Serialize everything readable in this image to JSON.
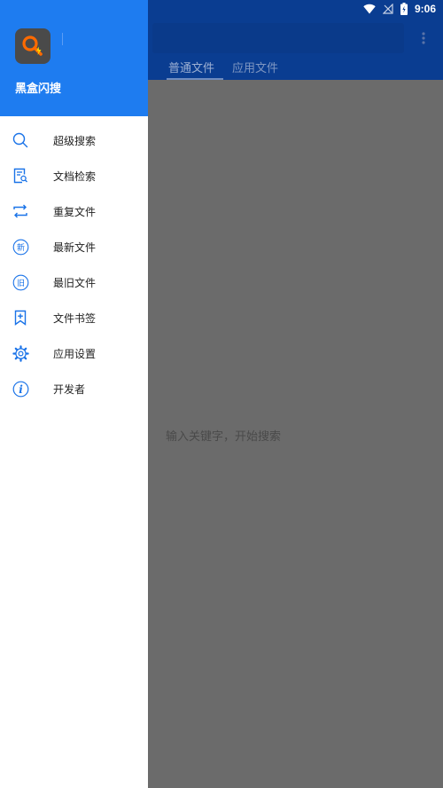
{
  "status_bar": {
    "time": "9:06"
  },
  "main": {
    "tabs": [
      {
        "label": "普通文件",
        "active": true
      },
      {
        "label": "应用文件",
        "active": false
      }
    ],
    "empty_hint": "输入关键字，开始搜索"
  },
  "drawer": {
    "app_name": "黑盒闪搜",
    "items": [
      {
        "label": "超级搜索",
        "icon": "search-icon"
      },
      {
        "label": "文档检索",
        "icon": "document-search-icon"
      },
      {
        "label": "重复文件",
        "icon": "repeat-icon"
      },
      {
        "label": "最新文件",
        "icon": "new-badge-icon"
      },
      {
        "label": "最旧文件",
        "icon": "old-badge-icon"
      },
      {
        "label": "文件书签",
        "icon": "bookmark-add-icon"
      },
      {
        "label": "应用设置",
        "icon": "gear-icon"
      },
      {
        "label": "开发者",
        "icon": "info-icon"
      }
    ]
  },
  "colors": {
    "accent": "#1e7cf0",
    "toolbar": "#0a3d91",
    "scrim": "#6b6b6b",
    "icon": "#1a73e8"
  }
}
